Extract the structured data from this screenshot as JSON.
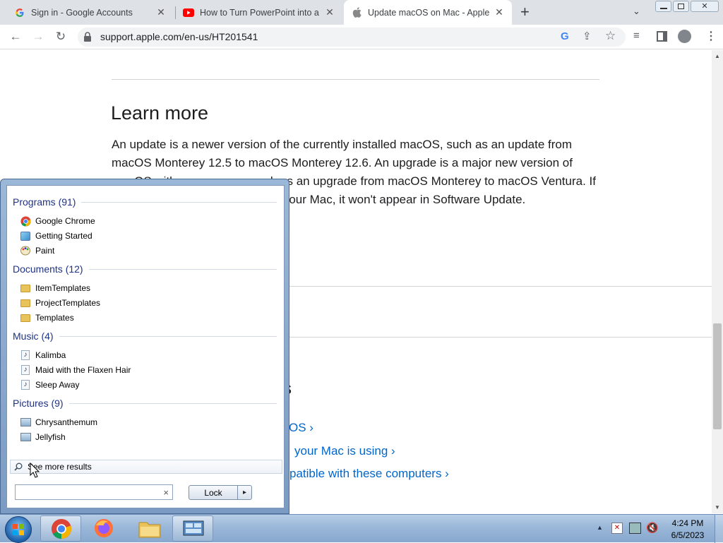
{
  "browser": {
    "tabs": [
      {
        "title": "Sign in - Google Accounts",
        "active": false
      },
      {
        "title": "How to Turn PowerPoint into a V",
        "active": false
      },
      {
        "title": "Update macOS on Mac - Apple S",
        "active": true
      }
    ],
    "new_tab_label": "+",
    "url": "support.apple.com/en-us/HT201541"
  },
  "page": {
    "heading": "Learn more",
    "paragraph_lines": [
      "An update is a newer version of the currently installed macOS, such as an update from",
      "macOS Monterey 12.5 to macOS Monterey 12.6. An upgrade is a major new version of",
      "macOS with a new name, such as an upgrade from macOS Monterey to macOS Ventura. If",
      "a macOS is not compatible with your Mac, it won't appear in Software Update."
    ],
    "partial_heading": "s",
    "links": [
      "OS ›",
      "your Mac is using ›",
      "patible with these computers ›"
    ]
  },
  "start_menu": {
    "groups": [
      {
        "header": "Programs (91)",
        "items": [
          {
            "label": "Google Chrome",
            "icon": "chrome-icon"
          },
          {
            "label": "Getting Started",
            "icon": "getting-started-icon"
          },
          {
            "label": "Paint",
            "icon": "paint-icon"
          }
        ]
      },
      {
        "header": "Documents (12)",
        "items": [
          {
            "label": "ItemTemplates",
            "icon": "folder-icon"
          },
          {
            "label": "ProjectTemplates",
            "icon": "folder-icon"
          },
          {
            "label": "Templates",
            "icon": "folder-icon"
          }
        ]
      },
      {
        "header": "Music (4)",
        "items": [
          {
            "label": "Kalimba",
            "icon": "music-file-icon"
          },
          {
            "label": "Maid with the Flaxen Hair",
            "icon": "music-file-icon"
          },
          {
            "label": "Sleep Away",
            "icon": "music-file-icon"
          }
        ]
      },
      {
        "header": "Pictures (9)",
        "items": [
          {
            "label": "Chrysanthemum",
            "icon": "picture-file-icon"
          },
          {
            "label": "Jellyfish",
            "icon": "picture-file-icon"
          }
        ]
      }
    ],
    "see_more": "See more results",
    "search_value": "",
    "clear_label": "×",
    "lock_label": "Lock",
    "arrow_label": "▸"
  },
  "taskbar": {
    "time": "4:24 PM",
    "date": "6/5/2023"
  }
}
